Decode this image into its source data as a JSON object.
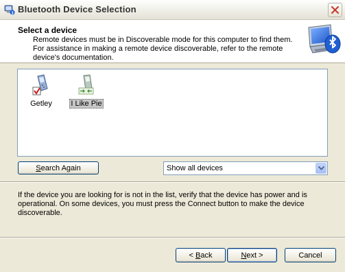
{
  "window": {
    "title": "Bluetooth Device Selection"
  },
  "header": {
    "title": "Select a device",
    "description": "Remote devices must be in Discoverable mode for this computer to find them. For assistance in making a remote device discoverable, refer to the remote device's documentation."
  },
  "devices": [
    {
      "label": "Getley",
      "icon": "phone-checked-icon",
      "selected": false
    },
    {
      "label": "I Like Pie",
      "icon": "phone-connecting-icon",
      "selected": true
    }
  ],
  "controls": {
    "search_label_u": "S",
    "search_label_rest": "earch Again",
    "filter_value": "Show all devices"
  },
  "help_text": "If the device you are looking for is not in the list, verify that the device has power and is operational. On some devices, you must press the Connect button to make the device discoverable.",
  "buttons": {
    "back_prefix": "< ",
    "back_u": "B",
    "back_rest": "ack",
    "next_u": "N",
    "next_rest": "ext >",
    "cancel": "Cancel"
  },
  "colors": {
    "window_bg": "#ece9d8",
    "list_border": "#7f9db9",
    "button_border": "#003c74",
    "close_x": "#c4372a"
  }
}
